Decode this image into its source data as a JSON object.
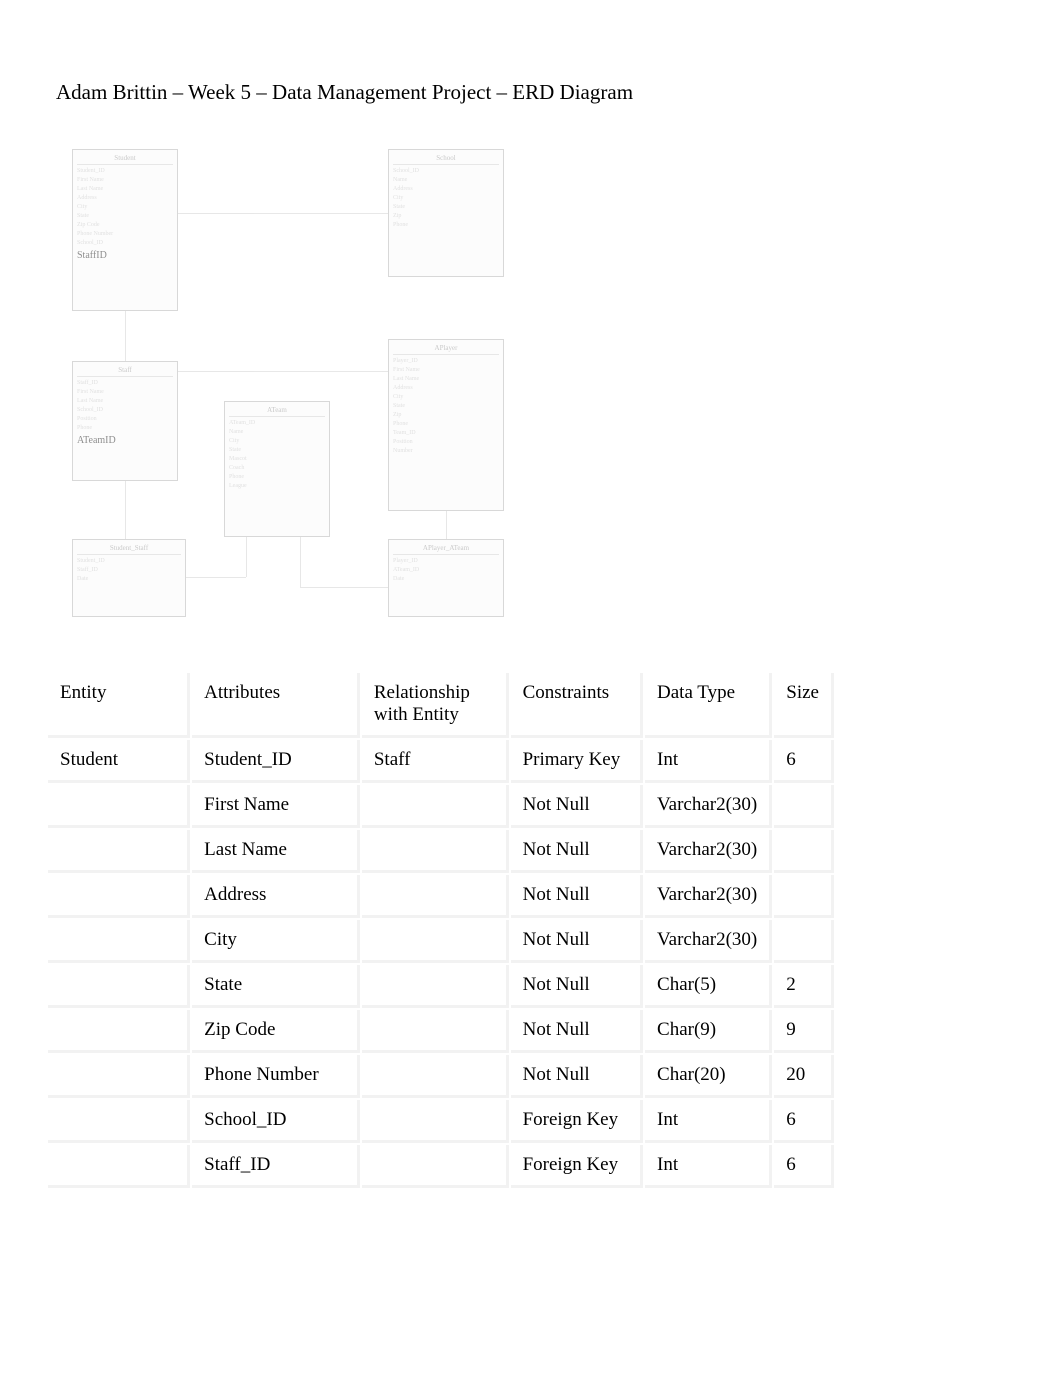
{
  "title": "Adam Brittin – Week 5 – Data Management Project – ERD Diagram",
  "erd": {
    "boxes": {
      "student": {
        "header": "Student",
        "attrs": [
          "Student_ID",
          "First Name",
          "Last Name",
          "Address",
          "City",
          "State",
          "Zip Code",
          "Phone Number",
          "School_ID"
        ],
        "bold_attr": "StaffID"
      },
      "school": {
        "header": "School",
        "attrs": [
          "School_ID",
          "Name",
          "Address",
          "City",
          "State",
          "Zip",
          "Phone"
        ]
      },
      "staff": {
        "header": "Staff",
        "attrs": [
          "Staff_ID",
          "First Name",
          "Last Name",
          "School_ID",
          "Position",
          "Phone"
        ],
        "bold_attr": "ATeamID"
      },
      "aplayer": {
        "header": "APlayer",
        "attrs": [
          "Player_ID",
          "First Name",
          "Last Name",
          "Address",
          "City",
          "State",
          "Zip",
          "Phone",
          "Team_ID",
          "Position",
          "Number"
        ]
      },
      "ateam": {
        "header": "ATeam",
        "attrs": [
          "ATeam_ID",
          "Name",
          "City",
          "State",
          "Mascot",
          "Coach",
          "Phone",
          "League"
        ]
      },
      "assoc_left": {
        "header": "Student_Staff",
        "attrs": [
          "Student_ID",
          "Staff_ID",
          "Date"
        ]
      },
      "assoc_right": {
        "header": "APlayer_ATeam",
        "attrs": [
          "Player_ID",
          "ATeam_ID",
          "Date"
        ]
      }
    }
  },
  "table": {
    "headers": {
      "entity": "Entity",
      "attributes": "Attributes",
      "relationship": "Relationship with Entity",
      "constraints": "Constraints",
      "datatype": "Data Type",
      "size": "Size"
    },
    "rows": [
      {
        "entity": "Student",
        "attribute": "Student_ID",
        "relationship": "Staff",
        "constraint": "Primary Key",
        "datatype": "Int",
        "size": "6"
      },
      {
        "entity": "",
        "attribute": "First Name",
        "relationship": "",
        "constraint": "Not Null",
        "datatype": "Varchar2(30)",
        "size": ""
      },
      {
        "entity": "",
        "attribute": "Last Name",
        "relationship": "",
        "constraint": "Not Null",
        "datatype": "Varchar2(30)",
        "size": ""
      },
      {
        "entity": "",
        "attribute": "Address",
        "relationship": "",
        "constraint": "Not Null",
        "datatype": "Varchar2(30)",
        "size": ""
      },
      {
        "entity": "",
        "attribute": "City",
        "relationship": "",
        "constraint": "Not Null",
        "datatype": "Varchar2(30)",
        "size": ""
      },
      {
        "entity": "",
        "attribute": "State",
        "relationship": "",
        "constraint": "Not Null",
        "datatype": "Char(5)",
        "size": "2"
      },
      {
        "entity": "",
        "attribute": "Zip Code",
        "relationship": "",
        "constraint": "Not Null",
        "datatype": "Char(9)",
        "size": "9"
      },
      {
        "entity": "",
        "attribute": "Phone Number",
        "relationship": "",
        "constraint": "Not Null",
        "datatype": "Char(20)",
        "size": "20"
      },
      {
        "entity": "",
        "attribute": "School_ID",
        "relationship": "",
        "constraint": "Foreign Key",
        "datatype": "Int",
        "size": "6"
      },
      {
        "entity": "",
        "attribute": "Staff_ID",
        "relationship": "",
        "constraint": "Foreign Key",
        "datatype": "Int",
        "size": "6"
      }
    ]
  }
}
